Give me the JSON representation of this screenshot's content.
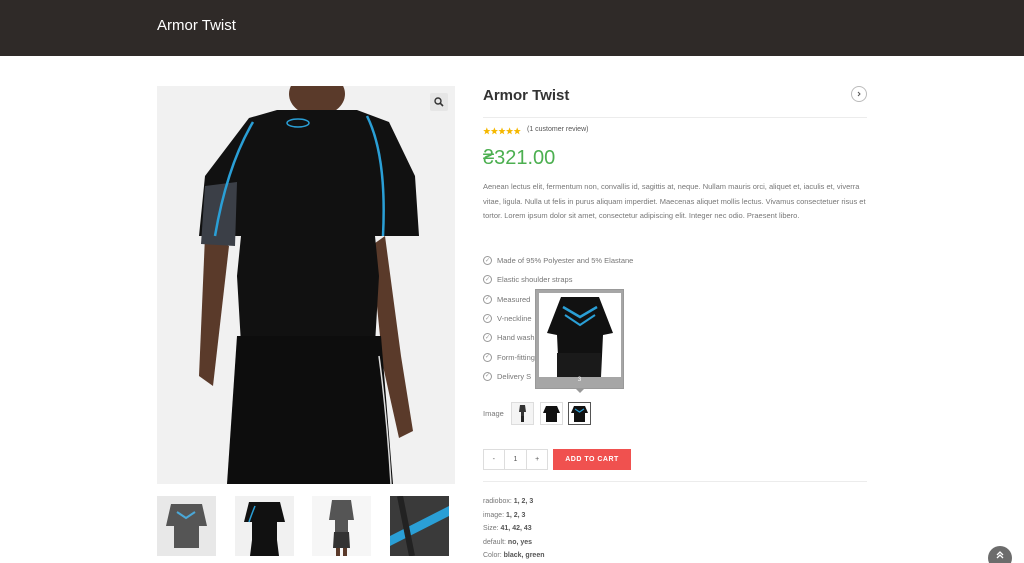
{
  "header": {
    "site_title": "Armor Twist"
  },
  "product": {
    "title": "Armor Twist",
    "rating": 5,
    "review_link": "(1 customer review)",
    "price": "₴321.00",
    "description": "Aenean lectus elit, fermentum non, convallis id, sagittis at, neque. Nullam mauris orci, aliquet et, iaculis et, viverra vitae, ligula. Nulla ut felis in purus aliquam imperdiet. Maecenas aliquet mollis lectus. Vivamus consectetuer risus et tortor. Lorem ipsum dolor sit amet, consectetur adipiscing elit. Integer nec odio. Praesent libero.",
    "features": [
      "Made of 95% Polyester and 5% Elastane",
      "Elastic shoulder straps",
      "Measured",
      "V-neckline",
      "Hand wash",
      "Form-fitting",
      "Delivery S"
    ],
    "variation": {
      "label": "Image",
      "tooltip_number": "3",
      "selected_index": 2
    },
    "quantity": {
      "minus": "-",
      "value": "1",
      "plus": "+"
    },
    "add_to_cart": "ADD TO CART",
    "attributes": [
      {
        "name": "radiobox:",
        "value": "1, 2, 3"
      },
      {
        "name": "image:",
        "value": "1, 2, 3"
      },
      {
        "name": "Size:",
        "value": "41, 42, 43"
      },
      {
        "name": "default:",
        "value": "no, yes"
      },
      {
        "name": "Color:",
        "value": "black, green"
      }
    ]
  },
  "icons": {
    "zoom": "magnifier-icon",
    "next": "chevron-right-icon",
    "check": "check-circle-icon",
    "scroll_top": "double-chevron-up-icon"
  },
  "colors": {
    "header_bg": "#2f2a28",
    "price": "#4caf50",
    "cart_button": "#f0514f",
    "star": "#f5b800",
    "shirt_accent": "#2a9fd6"
  }
}
